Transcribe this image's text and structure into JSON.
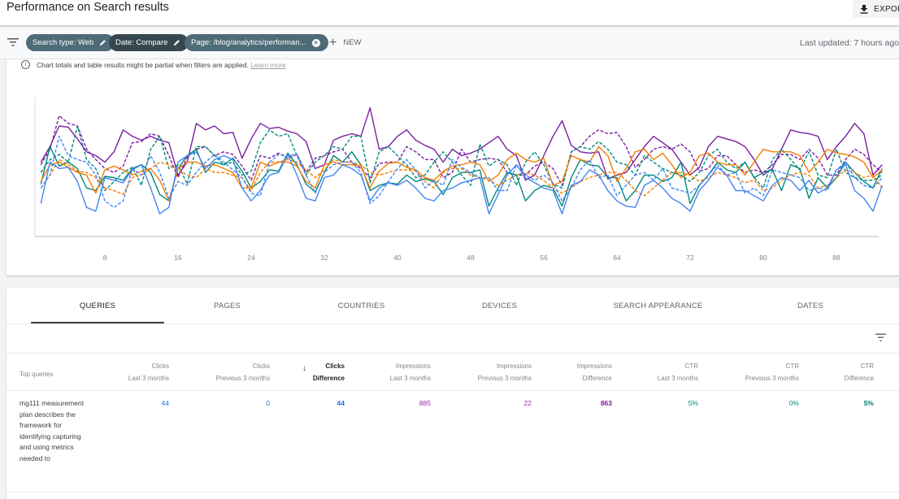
{
  "header": {
    "title": "Performance on Search results",
    "export_label": "EXPORT"
  },
  "filters": {
    "chips": [
      {
        "label": "Search type: Web",
        "action_icon": "edit-icon"
      },
      {
        "label": "Date: Compare",
        "action_icon": "edit-icon"
      },
      {
        "label": "Page: /blog/analytics/performan...",
        "action_icon": "clear-icon"
      }
    ],
    "new_label": "NEW",
    "last_updated": "Last updated: 7 hours ago"
  },
  "notice": {
    "text": "Chart totals and table results might be partial when filters are applied.",
    "link": "Learn more"
  },
  "colors": {
    "clicks": "#4285f4",
    "impressions": "#7b1fa2",
    "ctr": "#00897b",
    "position": "#f57c00",
    "chip_bg": "#4e6b78",
    "chip_active_bg": "#37474f"
  },
  "chart_data": {
    "type": "line",
    "title": "",
    "xlabel": "",
    "ylabel": "",
    "x_range": [
      1,
      92
    ],
    "y_range": [
      0,
      100
    ],
    "x_ticks": [
      8,
      16,
      24,
      32,
      40,
      48,
      56,
      64,
      72,
      80,
      88
    ],
    "grid": false,
    "series": [
      {
        "name": "Impressions (Last 3 months)",
        "color": "#7b1fa2",
        "dash": false,
        "values": [
          50,
          62,
          78,
          77,
          68,
          58,
          55,
          50,
          58,
          75,
          70,
          67,
          70,
          67,
          65,
          40,
          50,
          80,
          75,
          78,
          72,
          73,
          53,
          68,
          80,
          76,
          77,
          74,
          72,
          66,
          45,
          48,
          67,
          70,
          72,
          70,
          92,
          60,
          62,
          70,
          75,
          67,
          63,
          60,
          50,
          60,
          55,
          57,
          60,
          65,
          70,
          60,
          55,
          36,
          40,
          55,
          70,
          82,
          63,
          58,
          57,
          58,
          37,
          40,
          42,
          52,
          62,
          70,
          65,
          60,
          50,
          40,
          46,
          62,
          70,
          68,
          66,
          62,
          52,
          40,
          45,
          60,
          75,
          73,
          72,
          70,
          52,
          62,
          70,
          80,
          72,
          40,
          48
        ]
      },
      {
        "name": "Impressions (Previous 3 months)",
        "color": "#7b1fa2",
        "dash": true,
        "values": [
          48,
          60,
          86,
          80,
          78,
          60,
          52,
          45,
          42,
          47,
          65,
          66,
          72,
          70,
          55,
          38,
          54,
          60,
          62,
          55,
          58,
          56,
          47,
          36,
          55,
          53,
          57,
          53,
          56,
          42,
          53,
          55,
          58,
          60,
          50,
          45,
          38,
          49,
          50,
          50,
          62,
          58,
          52,
          52,
          38,
          42,
          60,
          50,
          52,
          53,
          52,
          42,
          40,
          40,
          47,
          50,
          45,
          32,
          58,
          62,
          70,
          75,
          72,
          73,
          62,
          46,
          52,
          60,
          62,
          60,
          64,
          58,
          43,
          45,
          55,
          55,
          48,
          42,
          44,
          42,
          48,
          56,
          56,
          52,
          60,
          53,
          40,
          40,
          52,
          60,
          56,
          48,
          42
        ]
      },
      {
        "name": "CTR (Last 3 months)",
        "color": "#00897b",
        "dash": false,
        "values": [
          33,
          62,
          47,
          50,
          45,
          30,
          28,
          39,
          38,
          36,
          45,
          48,
          42,
          25,
          20,
          45,
          55,
          60,
          42,
          50,
          48,
          53,
          43,
          30,
          35,
          44,
          43,
          57,
          48,
          33,
          27,
          42,
          55,
          50,
          58,
          48,
          28,
          32,
          34,
          33,
          40,
          35,
          37,
          35,
          25,
          38,
          42,
          42,
          44,
          16,
          30,
          42,
          40,
          20,
          28,
          32,
          30,
          16,
          38,
          52,
          48,
          47,
          38,
          38,
          20,
          28,
          40,
          40,
          35,
          38,
          50,
          18,
          32,
          40,
          50,
          44,
          42,
          50,
          38,
          42,
          44,
          28,
          48,
          45,
          22,
          38,
          30,
          38,
          50,
          42,
          35,
          30,
          45
        ]
      },
      {
        "name": "CTR (Previous 3 months)",
        "color": "#00897b",
        "dash": true,
        "values": [
          42,
          52,
          56,
          50,
          78,
          52,
          45,
          28,
          35,
          42,
          46,
          32,
          60,
          70,
          45,
          48,
          33,
          62,
          62,
          55,
          48,
          50,
          40,
          43,
          65,
          75,
          70,
          72,
          55,
          40,
          50,
          55,
          62,
          60,
          70,
          70,
          34,
          58,
          62,
          55,
          48,
          38,
          40,
          50,
          58,
          50,
          40,
          32,
          64,
          47,
          52,
          48,
          32,
          50,
          58,
          48,
          33,
          30,
          58,
          62,
          60,
          66,
          60,
          50,
          48,
          40,
          55,
          50,
          45,
          42,
          40,
          35,
          42,
          55,
          60,
          50,
          45,
          50,
          38,
          30,
          52,
          60,
          52,
          44,
          58,
          40,
          38,
          60,
          42,
          38,
          36,
          36,
          40
        ]
      },
      {
        "name": "Position (Last 3 months)",
        "color": "#f57c00",
        "dash": false,
        "values": [
          35,
          48,
          50,
          46,
          42,
          40,
          26,
          44,
          47,
          44,
          40,
          43,
          45,
          36,
          20,
          45,
          50,
          50,
          47,
          48,
          45,
          42,
          30,
          30,
          50,
          47,
          50,
          50,
          47,
          35,
          30,
          48,
          50,
          48,
          48,
          47,
          30,
          43,
          49,
          50,
          46,
          44,
          38,
          36,
          43,
          47,
          48,
          50,
          48,
          35,
          40,
          52,
          57,
          52,
          50,
          53,
          32,
          35,
          55,
          52,
          50,
          62,
          55,
          35,
          45,
          58,
          60,
          52,
          57,
          48,
          38,
          42,
          55,
          57,
          50,
          48,
          48,
          40,
          50,
          60,
          58,
          58,
          58,
          55,
          42,
          50,
          60,
          57,
          56,
          54,
          50,
          38,
          44
        ]
      },
      {
        "name": "Position (Previous 3 months)",
        "color": "#f57c00",
        "dash": true,
        "values": [
          30,
          40,
          52,
          48,
          43,
          42,
          38,
          30,
          28,
          25,
          38,
          40,
          45,
          50,
          48,
          44,
          40,
          38,
          45,
          42,
          42,
          40,
          38,
          28,
          42,
          50,
          50,
          52,
          50,
          44,
          38,
          44,
          52,
          50,
          50,
          48,
          42,
          40,
          42,
          44,
          44,
          43,
          35,
          30,
          42,
          45,
          45,
          40,
          38,
          36,
          32,
          36,
          40,
          42,
          40,
          36,
          30,
          26,
          30,
          35,
          38,
          40,
          42,
          42,
          36,
          28,
          24,
          30,
          36,
          42,
          42,
          40,
          35,
          38,
          42,
          40,
          38,
          34,
          36,
          28,
          30,
          36,
          40,
          42,
          40,
          30,
          32,
          38,
          44,
          42,
          38,
          40,
          30
        ]
      },
      {
        "name": "Clicks (Last 3 months)",
        "color": "#4285f4",
        "dash": false,
        "values": [
          18,
          50,
          45,
          46,
          35,
          15,
          12,
          38,
          36,
          34,
          44,
          48,
          30,
          10,
          15,
          50,
          55,
          58,
          45,
          52,
          55,
          52,
          30,
          20,
          28,
          40,
          42,
          56,
          40,
          22,
          20,
          38,
          40,
          48,
          45,
          40,
          20,
          30,
          34,
          32,
          36,
          30,
          22,
          20,
          28,
          30,
          34,
          36,
          38,
          10,
          25,
          40,
          48,
          38,
          34,
          30,
          28,
          10,
          32,
          35,
          44,
          40,
          28,
          20,
          16,
          15,
          32,
          36,
          30,
          22,
          18,
          12,
          28,
          36,
          46,
          40,
          28,
          28,
          24,
          20,
          32,
          38,
          36,
          28,
          36,
          26,
          30,
          44,
          48,
          28,
          22,
          12,
          32
        ]
      },
      {
        "name": "Clicks (Previous 3 months)",
        "color": "#4285f4",
        "dash": true,
        "values": [
          30,
          40,
          70,
          55,
          52,
          50,
          40,
          20,
          15,
          20,
          45,
          40,
          55,
          42,
          22,
          35,
          32,
          42,
          50,
          56,
          50,
          44,
          38,
          26,
          24,
          50,
          56,
          55,
          56,
          40,
          26,
          42,
          48,
          50,
          50,
          42,
          18,
          24,
          35,
          45,
          52,
          44,
          30,
          36,
          32,
          52,
          46,
          42,
          38,
          38,
          28,
          28,
          48,
          40,
          36,
          40,
          34,
          20,
          30,
          44,
          52,
          38,
          40,
          24,
          32,
          40,
          42,
          36,
          45,
          30,
          28,
          26,
          32,
          40,
          48,
          40,
          42,
          26,
          30,
          24,
          44,
          42,
          40,
          38,
          28,
          30,
          28,
          44,
          50,
          38,
          32,
          30,
          38
        ]
      }
    ]
  },
  "tabs": [
    {
      "label": "QUERIES",
      "active": true
    },
    {
      "label": "PAGES",
      "active": false
    },
    {
      "label": "COUNTRIES",
      "active": false
    },
    {
      "label": "DEVICES",
      "active": false
    },
    {
      "label": "SEARCH APPEARANCE",
      "active": false
    },
    {
      "label": "DATES",
      "active": false
    }
  ],
  "table": {
    "first_column_header": "Top queries",
    "columns": [
      {
        "metric": "Clicks",
        "period": "Last 3 months",
        "sorted": false
      },
      {
        "metric": "Clicks",
        "period": "Previous 3 months",
        "sorted": false
      },
      {
        "metric": "Clicks",
        "period": "Difference",
        "sorted": true,
        "sort_direction": "descending"
      },
      {
        "metric": "Impressions",
        "period": "Last 3 months",
        "sorted": false
      },
      {
        "metric": "Impressions",
        "period": "Previous 3 months",
        "sorted": false
      },
      {
        "metric": "Impressions",
        "period": "Difference",
        "sorted": false
      },
      {
        "metric": "CTR",
        "period": "Last 3 months",
        "sorted": false
      },
      {
        "metric": "CTR",
        "period": "Previous 3 months",
        "sorted": false
      },
      {
        "metric": "CTR",
        "period": "Difference",
        "sorted": false
      }
    ],
    "rows": [
      {
        "query": "mg111 measurement plan describes the framework for identifying capturing and using metrics needed to",
        "values": [
          "44",
          "0",
          "44",
          "885",
          "22",
          "863",
          "5%",
          "0%",
          "5%"
        ]
      }
    ]
  }
}
